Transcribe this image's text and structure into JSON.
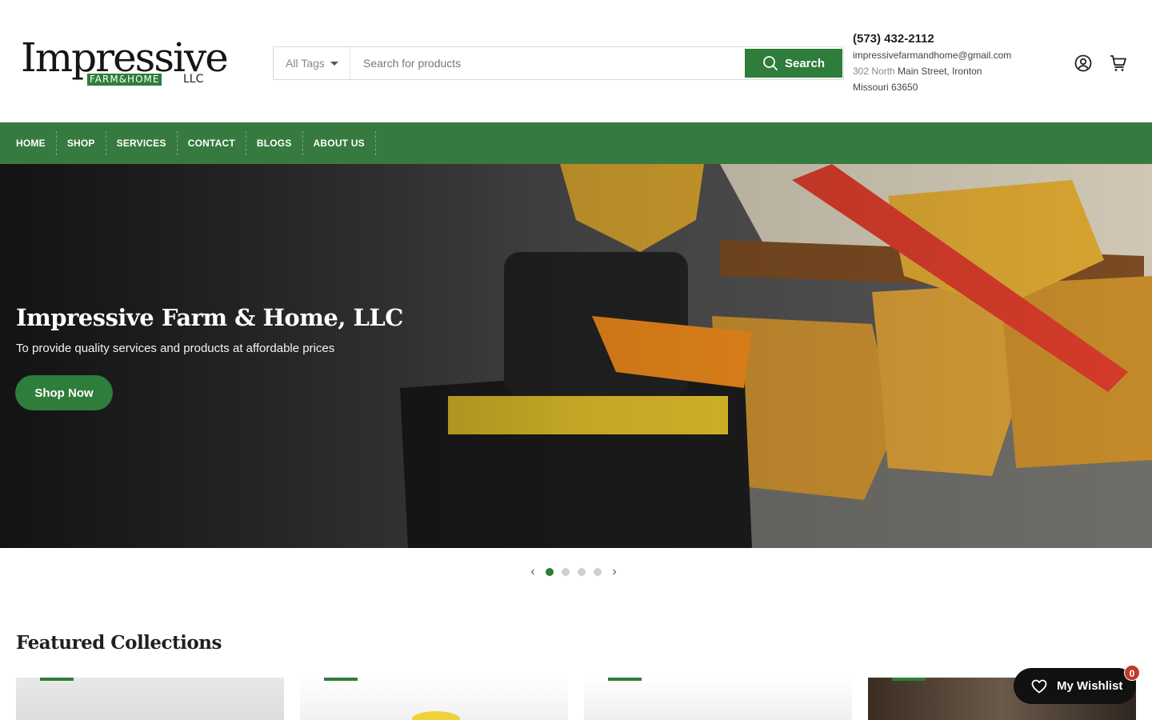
{
  "brand": {
    "word": "Impressive",
    "tagline": "FARM&HOME",
    "suffix": "LLC"
  },
  "search": {
    "tags_label": "All Tags",
    "placeholder": "Search for products",
    "button_label": "Search"
  },
  "contact": {
    "phone": "(573) 432-2112",
    "email": "impressivefarmandhome@gmail.com",
    "address_muted": "302 North",
    "address_line1": "Main Street, Ironton",
    "address_line2": "Missouri 63650"
  },
  "nav": {
    "items": [
      "HOME",
      "SHOP",
      "SERVICES",
      "CONTACT",
      "BLOGS",
      "ABOUT US"
    ]
  },
  "hero": {
    "title": "Impressive Farm & Home, LLC",
    "subtitle": "To provide quality services and products at affordable prices",
    "cta": "Shop Now"
  },
  "slider": {
    "total": 4,
    "active": 1
  },
  "featured": {
    "title": "Featured Collections"
  },
  "wishlist": {
    "label": "My Wishlist",
    "count": "0"
  },
  "icons": {
    "search": "search-icon",
    "account": "user-circle-icon",
    "cart": "cart-icon",
    "wishlist": "heart-icon"
  },
  "colors": {
    "brand_green": "#2e7d3a",
    "nav_green": "#367a3f",
    "badge_red": "#c0392b"
  }
}
